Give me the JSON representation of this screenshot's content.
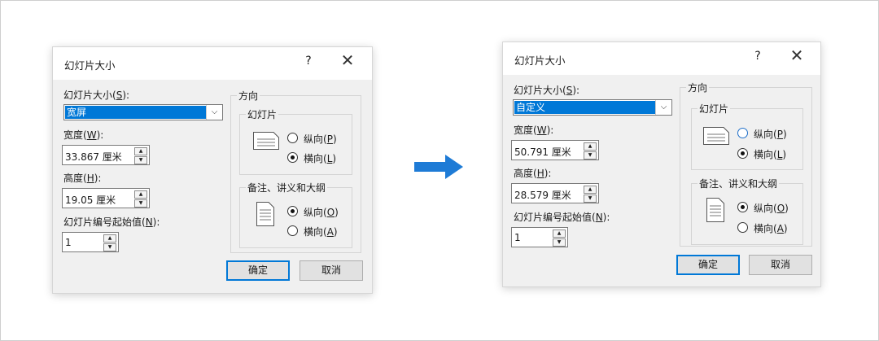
{
  "accent_color": "#0078d7",
  "arrow_color": "#1e7bd6",
  "dialog_before": {
    "title": "幻灯片大小",
    "help_label": "?",
    "close_label": "✕",
    "size_label": "幻灯片大小(",
    "size_key": "S",
    "size_suffix": "):",
    "size_value": "宽屏",
    "width_label": "宽度(",
    "width_key": "W",
    "width_suffix": "):",
    "width_value": "33.867 厘米",
    "height_label": "高度(",
    "height_key": "H",
    "height_suffix": "):",
    "height_value": "19.05 厘米",
    "number_label": "幻灯片编号起始值(",
    "number_key": "N",
    "number_suffix": "):",
    "number_value": "1",
    "orientation_title": "方向",
    "slides_group": "幻灯片",
    "portrait_label": "纵向(",
    "portrait_key": "P",
    "landscape_label": "横向(",
    "landscape_key": "L",
    "slides_selected": "landscape",
    "notes_group": "备注、讲义和大纲",
    "notes_portrait_label": "纵向(",
    "notes_portrait_key": "O",
    "notes_landscape_label": "横向(",
    "notes_landscape_key": "A",
    "notes_selected": "portrait",
    "ok_label": "确定",
    "cancel_label": "取消"
  },
  "dialog_after": {
    "title": "幻灯片大小",
    "help_label": "?",
    "close_label": "✕",
    "size_label": "幻灯片大小(",
    "size_key": "S",
    "size_suffix": "):",
    "size_value": "自定义",
    "width_label": "宽度(",
    "width_key": "W",
    "width_suffix": "):",
    "width_value": "50.791 厘米",
    "height_label": "高度(",
    "height_key": "H",
    "height_suffix": "):",
    "height_value": "28.579 厘米",
    "number_label": "幻灯片编号起始值(",
    "number_key": "N",
    "number_suffix": "):",
    "number_value": "1",
    "orientation_title": "方向",
    "slides_group": "幻灯片",
    "portrait_label": "纵向(",
    "portrait_key": "P",
    "landscape_label": "横向(",
    "landscape_key": "L",
    "slides_selected": "landscape",
    "notes_group": "备注、讲义和大纲",
    "notes_portrait_label": "纵向(",
    "notes_portrait_key": "O",
    "notes_landscape_label": "横向(",
    "notes_landscape_key": "A",
    "notes_selected": "portrait",
    "ok_label": "确定",
    "cancel_label": "取消"
  },
  "close_paren": ")"
}
